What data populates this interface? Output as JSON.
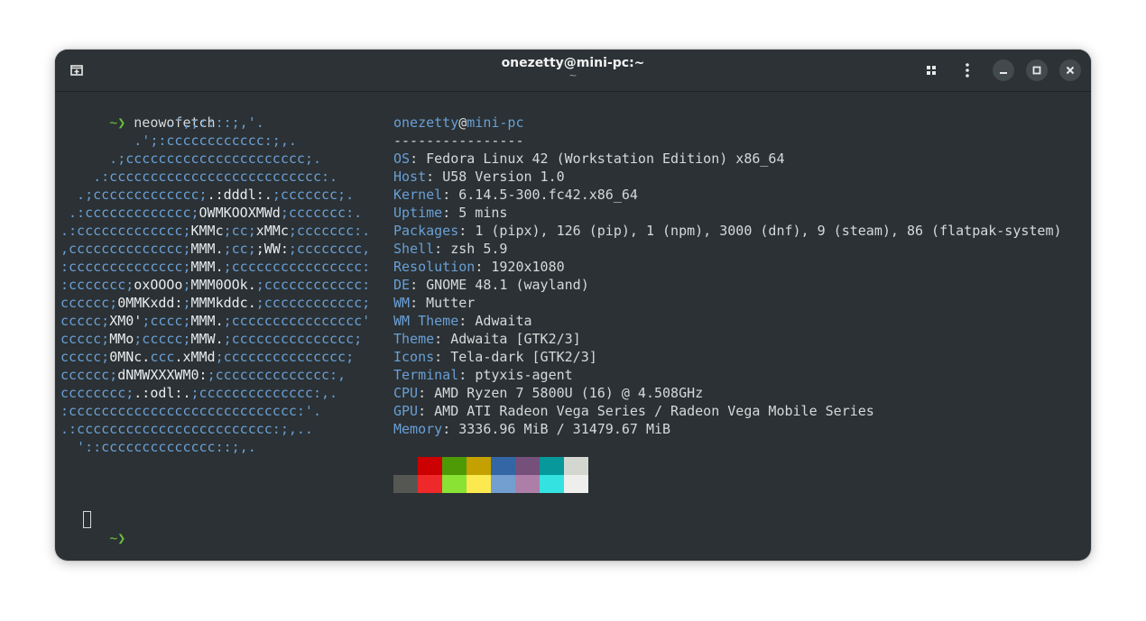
{
  "window": {
    "title": "onezetty@mini-pc:~",
    "subtitle": "~"
  },
  "titlebar_icons": {
    "new_tab": "new-tab-icon",
    "grid": "tab-overview-icon",
    "menu": "kebab-menu-icon",
    "minimize": "minimize-icon",
    "maximize": "maximize-icon",
    "close": "close-icon"
  },
  "terminal": {
    "prompt": "~❯",
    "command": "neowofetch",
    "logo_lines": [
      [
        [
          "b",
          "             .',;::::;,'."
        ]
      ],
      [
        [
          "b",
          "         .';:cccccccccccc:;,."
        ]
      ],
      [
        [
          "b",
          "      .;cccccccccccccccccccccc;."
        ]
      ],
      [
        [
          "b",
          "    .:cccccccccccccccccccccccccc:."
        ]
      ],
      [
        [
          "b",
          "  .;ccccccccccccc;"
        ],
        [
          "w",
          ".:dddl:."
        ],
        [
          "b",
          ";ccccccc;."
        ]
      ],
      [
        [
          "b",
          " .:ccccccccccccc;"
        ],
        [
          "w",
          "OWMKOOXMWd"
        ],
        [
          "b",
          ";ccccccc:."
        ]
      ],
      [
        [
          "b",
          ".:ccccccccccccc;"
        ],
        [
          "w",
          "KMMc"
        ],
        [
          "b",
          ";cc;"
        ],
        [
          "w",
          "xMMc"
        ],
        [
          "b",
          ";ccccccc:."
        ]
      ],
      [
        [
          "b",
          ",cccccccccccccc;"
        ],
        [
          "w",
          "MMM."
        ],
        [
          "b",
          ";cc;"
        ],
        [
          "w",
          ";WW:"
        ],
        [
          "b",
          ";cccccccc,"
        ]
      ],
      [
        [
          "b",
          ":cccccccccccccc;"
        ],
        [
          "w",
          "MMM."
        ],
        [
          "b",
          ";cccccccccccccccc:"
        ]
      ],
      [
        [
          "b",
          ":ccccccc;"
        ],
        [
          "w",
          "oxOOOo"
        ],
        [
          "b",
          ";"
        ],
        [
          "w",
          "MMM0OOk."
        ],
        [
          "b",
          ";cccccccccccc:"
        ]
      ],
      [
        [
          "b",
          "cccccc;"
        ],
        [
          "w",
          "0MMKxdd:"
        ],
        [
          "b",
          ";"
        ],
        [
          "w",
          "MMMkddc."
        ],
        [
          "b",
          ";cccccccccccc;"
        ]
      ],
      [
        [
          "b",
          "ccccc;"
        ],
        [
          "w",
          "XM0'"
        ],
        [
          "b",
          ";cccc;"
        ],
        [
          "w",
          "MMM."
        ],
        [
          "b",
          ";cccccccccccccccc'"
        ]
      ],
      [
        [
          "b",
          "ccccc;"
        ],
        [
          "w",
          "MMo"
        ],
        [
          "b",
          ";ccccc;"
        ],
        [
          "w",
          "MMW."
        ],
        [
          "b",
          ";ccccccccccccccc;"
        ]
      ],
      [
        [
          "b",
          "ccccc;"
        ],
        [
          "w",
          "0MNc."
        ],
        [
          "b",
          "ccc"
        ],
        [
          "w",
          ".xMMd"
        ],
        [
          "b",
          ";ccccccccccccccc;"
        ]
      ],
      [
        [
          "b",
          "cccccc;"
        ],
        [
          "w",
          "dNMWXXXWM0:"
        ],
        [
          "b",
          ";cccccccccccccc:,"
        ]
      ],
      [
        [
          "b",
          "cccccccc;"
        ],
        [
          "w",
          ".:odl:."
        ],
        [
          "b",
          ";cccccccccccccc:,."
        ]
      ],
      [
        [
          "b",
          ":cccccccccccccccccccccccccccc:'."
        ]
      ],
      [
        [
          "b",
          ".:cccccccccccccccccccccccc:;,.."
        ]
      ],
      [
        [
          "b",
          "  '::cccccccccccccc::;,."
        ]
      ]
    ],
    "info": {
      "user": "onezetty",
      "at": "@",
      "host": "mini-pc",
      "separator": "----------------",
      "rows": [
        {
          "key": "OS",
          "value": "Fedora Linux 42 (Workstation Edition) x86_64"
        },
        {
          "key": "Host",
          "value": "U58 Version 1.0"
        },
        {
          "key": "Kernel",
          "value": "6.14.5-300.fc42.x86_64"
        },
        {
          "key": "Uptime",
          "value": "5 mins"
        },
        {
          "key": "Packages",
          "value": "1 (pipx), 126 (pip), 1 (npm), 3000 (dnf), 9 (steam), 86 (flatpak-system)"
        },
        {
          "key": "Shell",
          "value": "zsh 5.9"
        },
        {
          "key": "Resolution",
          "value": "1920x1080"
        },
        {
          "key": "DE",
          "value": "GNOME 48.1 (wayland)"
        },
        {
          "key": "WM",
          "value": "Mutter"
        },
        {
          "key": "WM Theme",
          "value": "Adwaita"
        },
        {
          "key": "Theme",
          "value": "Adwaita [GTK2/3]"
        },
        {
          "key": "Icons",
          "value": "Tela-dark [GTK2/3]"
        },
        {
          "key": "Terminal",
          "value": "ptyxis-agent"
        },
        {
          "key": "CPU",
          "value": "AMD Ryzen 7 5800U (16) @ 4.508GHz"
        },
        {
          "key": "GPU",
          "value": "AMD ATI Radeon Vega Series / Radeon Vega Mobile Series"
        },
        {
          "key": "Memory",
          "value": "3336.96 MiB / 31479.67 MiB"
        }
      ]
    },
    "palette_row1": [
      "#2b3134",
      "#cc0000",
      "#4e9a06",
      "#c4a000",
      "#3465a4",
      "#75507b",
      "#06989a",
      "#d3d7cf"
    ],
    "palette_row2": [
      "#555753",
      "#ef2929",
      "#8ae234",
      "#fce94f",
      "#729fcf",
      "#ad7fa8",
      "#34e2e2",
      "#eeeeec"
    ],
    "final_prompt": "~❯"
  }
}
